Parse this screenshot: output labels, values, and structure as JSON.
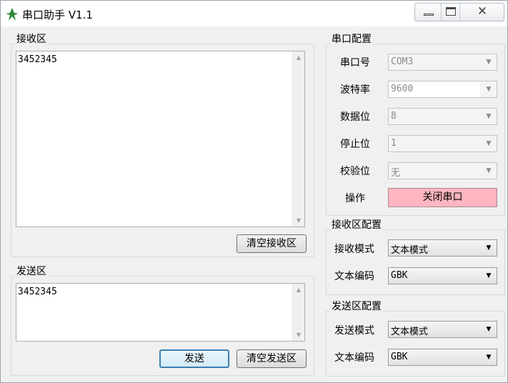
{
  "window": {
    "title": "串口助手 V1.1",
    "close_glyph": "✕"
  },
  "icons": {
    "app": "app-logo-icon",
    "minimize": "minimize-icon",
    "maximize": "maximize-icon",
    "close": "close-icon"
  },
  "receive_area": {
    "title": "接收区",
    "content": "3452345",
    "clear_button": "清空接收区"
  },
  "send_area": {
    "title": "发送区",
    "content": "3452345",
    "send_button": "发送",
    "clear_button": "清空发送区"
  },
  "serial_config": {
    "title": "串口配置",
    "port_label": "串口号",
    "port_value": "COM3",
    "baud_label": "波特率",
    "baud_value": "9600",
    "databits_label": "数据位",
    "databits_value": "8",
    "stopbits_label": "停止位",
    "stopbits_value": "1",
    "parity_label": "校验位",
    "parity_value": "无",
    "operation_label": "操作",
    "toggle_button": "关闭串口",
    "toggle_button_color": "#ffb6c1"
  },
  "receive_config": {
    "title": "接收区配置",
    "mode_label": "接收模式",
    "mode_value": "文本模式",
    "encoding_label": "文本编码",
    "encoding_value": "GBK"
  },
  "send_config": {
    "title": "发送区配置",
    "mode_label": "发送模式",
    "mode_value": "文本模式",
    "encoding_label": "文本编码",
    "encoding_value": "GBK"
  }
}
